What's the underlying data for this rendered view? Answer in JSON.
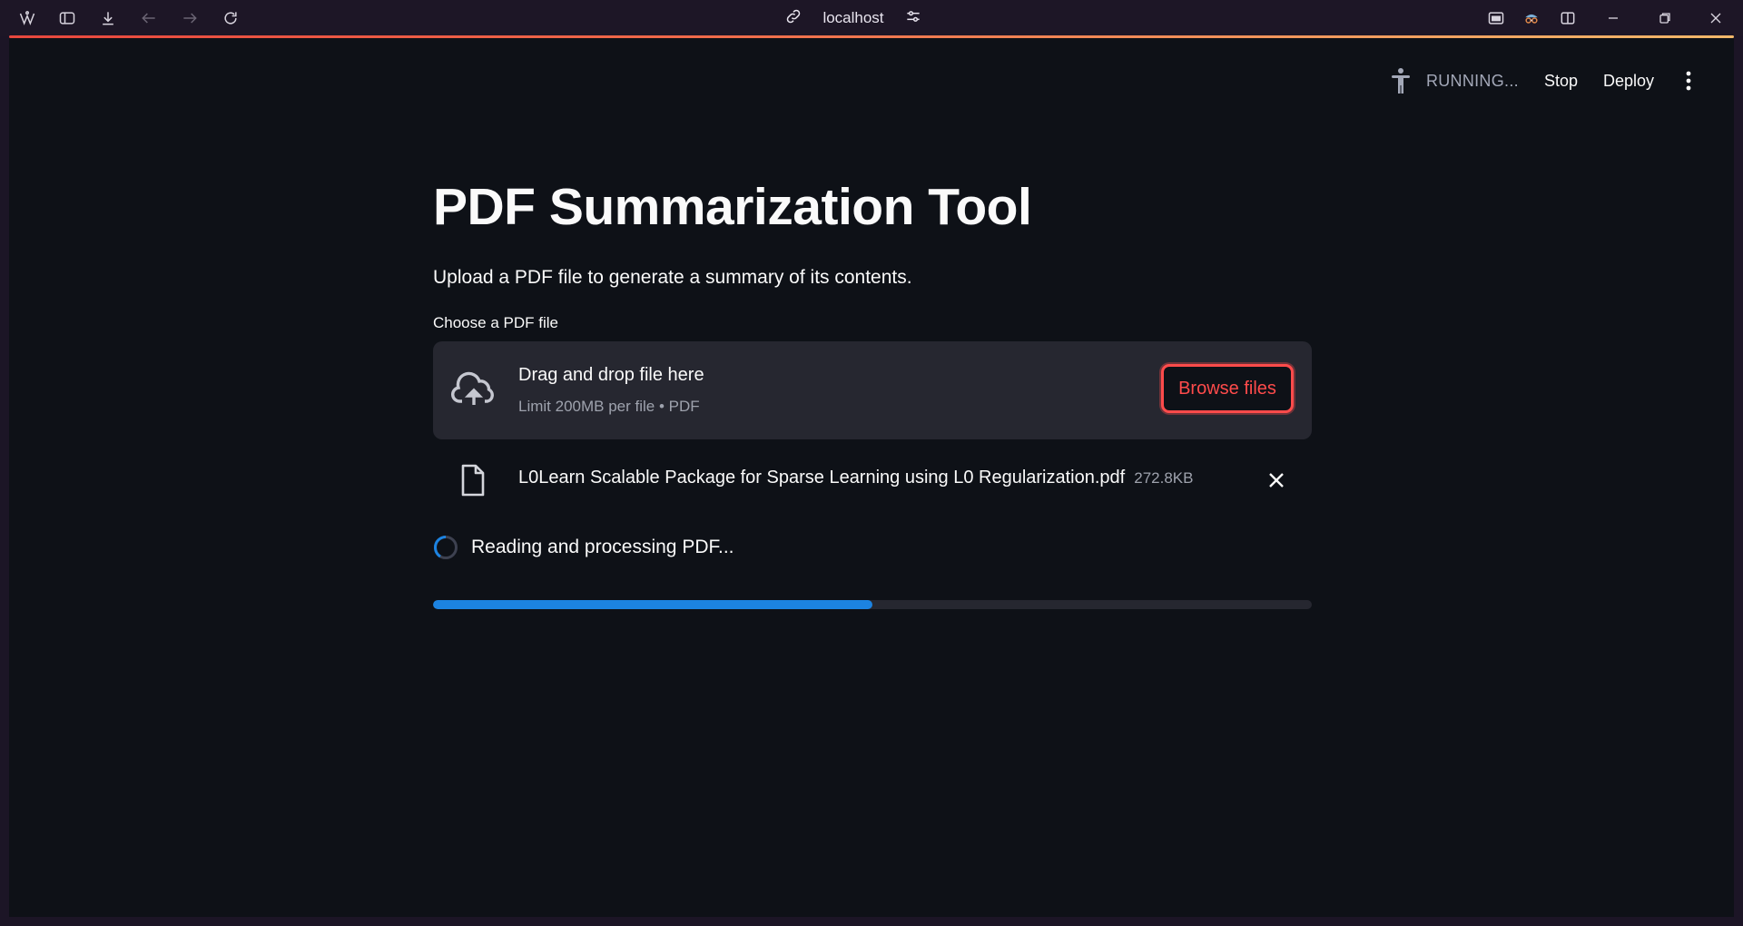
{
  "browser": {
    "url": "localhost",
    "icons": [
      "app-logo-icon",
      "sidebar-toggle-icon",
      "download-icon",
      "back-arrow-icon",
      "forward-arrow-icon",
      "reload-icon",
      "link-icon",
      "site-settings-icon",
      "reader-icon",
      "incognito-icon",
      "split-view-icon",
      "minimize-icon",
      "restore-icon",
      "close-icon"
    ]
  },
  "header": {
    "status": "RUNNING...",
    "stop_label": "Stop",
    "deploy_label": "Deploy"
  },
  "main": {
    "title": "PDF Summarization Tool",
    "subtitle": "Upload a PDF file to generate a summary of its contents.",
    "uploader": {
      "label": "Choose a PDF file",
      "drop_title": "Drag and drop file here",
      "drop_limit": "Limit 200MB per file • PDF",
      "browse_label": "Browse files"
    },
    "file": {
      "name": "L0Learn Scalable Package for Sparse Learning using L0 Regularization.pdf",
      "size": "272.8KB"
    },
    "status_text": "Reading and processing PDF...",
    "progress": 0.5
  },
  "colors": {
    "accent": "#ff4b4b",
    "progress": "#1c83e1",
    "background": "#0e1117",
    "panel": "#262730"
  }
}
